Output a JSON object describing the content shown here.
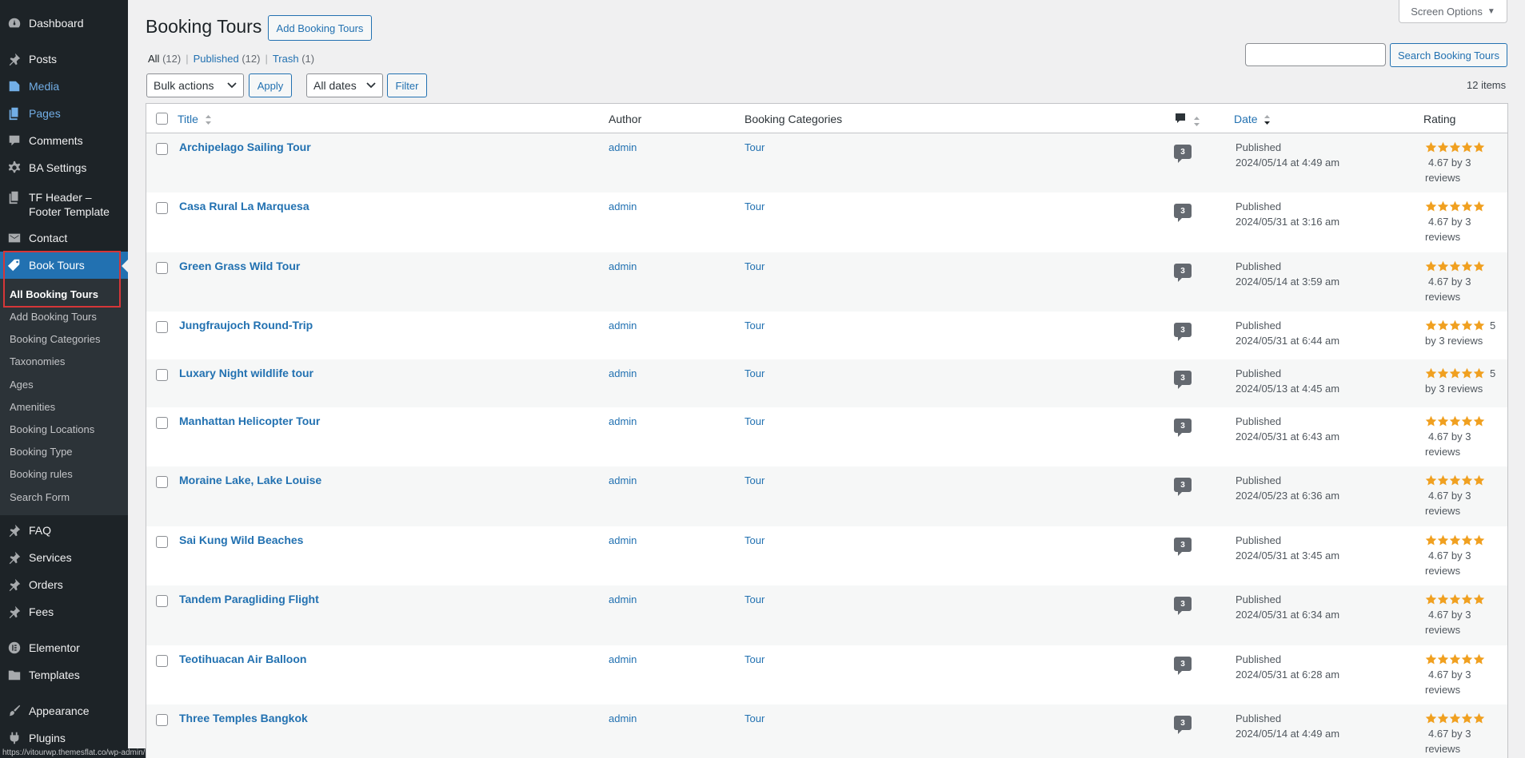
{
  "sidebar": {
    "menu": [
      {
        "label": "Dashboard",
        "icon": "dashboard-icon"
      },
      {
        "label": "Posts",
        "icon": "pin-icon"
      },
      {
        "label": "Media",
        "icon": "media-icon"
      },
      {
        "label": "Pages",
        "icon": "pages-icon"
      },
      {
        "label": "Comments",
        "icon": "comments-icon"
      },
      {
        "label": "BA Settings",
        "icon": "gear-icon"
      },
      {
        "label": "TF Header –",
        "label2": "Footer Template",
        "icon": "pages-icon"
      },
      {
        "label": "Contact",
        "icon": "mail-icon"
      },
      {
        "label": "Book Tours",
        "icon": "tag-icon"
      },
      {
        "label": "FAQ",
        "icon": "pin-icon"
      },
      {
        "label": "Services",
        "icon": "pin-icon"
      },
      {
        "label": "Orders",
        "icon": "pin-icon"
      },
      {
        "label": "Fees",
        "icon": "pin-icon"
      },
      {
        "label": "Elementor",
        "icon": "elementor-icon"
      },
      {
        "label": "Templates",
        "icon": "folder-icon"
      },
      {
        "label": "Appearance",
        "icon": "brush-icon"
      },
      {
        "label": "Plugins",
        "icon": "plugin-icon"
      }
    ],
    "submenu": [
      "All Booking Tours",
      "Add Booking Tours",
      "Booking Categories",
      "Taxonomies",
      "Ages",
      "Amenities",
      "Booking Locations",
      "Booking Type",
      "Booking rules",
      "Search Form"
    ]
  },
  "status_url": "https://vitourwp.themesflat.co/wp-admin/upload.php",
  "header": {
    "title": "Booking Tours",
    "add_button": "Add Booking Tours",
    "screen_options": "Screen Options"
  },
  "filters": {
    "all": "All",
    "all_count": "(12)",
    "published": "Published",
    "published_count": "(12)",
    "trash": "Trash",
    "trash_count": "(1)",
    "bulk_actions": "Bulk actions",
    "apply": "Apply",
    "all_dates": "All dates",
    "filter": "Filter",
    "search_button": "Search Booking Tours",
    "items_count": "12 items"
  },
  "columns": {
    "title": "Title",
    "author": "Author",
    "categories": "Booking Categories",
    "date": "Date",
    "rating": "Rating"
  },
  "colors": {
    "accent": "#2271b1",
    "sidebar": "#1d2327",
    "star": "#f0a020",
    "highlight_box": "#d63638"
  },
  "rows": [
    {
      "title": "Archipelago Sailing Tour",
      "author": "admin",
      "category": "Tour",
      "comments": "3",
      "status": "Published",
      "date": "2024/05/14 at 4:49 am",
      "rating_line1": "4.67 by 3",
      "rating_line2": "reviews",
      "stars": 5
    },
    {
      "title": "Casa Rural La Marquesa",
      "author": "admin",
      "category": "Tour",
      "comments": "3",
      "status": "Published",
      "date": "2024/05/31 at 3:16 am",
      "rating_line1": "4.67 by 3",
      "rating_line2": "reviews",
      "stars": 5
    },
    {
      "title": "Green Grass Wild Tour",
      "author": "admin",
      "category": "Tour",
      "comments": "3",
      "status": "Published",
      "date": "2024/05/14 at 3:59 am",
      "rating_line1": "4.67 by 3",
      "rating_line2": "reviews",
      "stars": 5
    },
    {
      "title": "Jungfraujoch Round-Trip",
      "author": "admin",
      "category": "Tour",
      "comments": "3",
      "status": "Published",
      "date": "2024/05/31 at 6:44 am",
      "rating_inline": "5",
      "rating_line2": "by 3 reviews",
      "stars": 5
    },
    {
      "title": "Luxary Night wildlife tour",
      "author": "admin",
      "category": "Tour",
      "comments": "3",
      "status": "Published",
      "date": "2024/05/13 at 4:45 am",
      "rating_inline": "5",
      "rating_line2": "by 3 reviews",
      "stars": 5
    },
    {
      "title": "Manhattan Helicopter Tour",
      "author": "admin",
      "category": "Tour",
      "comments": "3",
      "status": "Published",
      "date": "2024/05/31 at 6:43 am",
      "rating_line1": "4.67 by 3",
      "rating_line2": "reviews",
      "stars": 5
    },
    {
      "title": "Moraine Lake, Lake Louise",
      "author": "admin",
      "category": "Tour",
      "comments": "3",
      "status": "Published",
      "date": "2024/05/23 at 6:36 am",
      "rating_line1": "4.67 by 3",
      "rating_line2": "reviews",
      "stars": 5
    },
    {
      "title": "Sai Kung Wild Beaches",
      "author": "admin",
      "category": "Tour",
      "comments": "3",
      "status": "Published",
      "date": "2024/05/31 at 3:45 am",
      "rating_line1": "4.67 by 3",
      "rating_line2": "reviews",
      "stars": 5
    },
    {
      "title": "Tandem Paragliding Flight",
      "author": "admin",
      "category": "Tour",
      "comments": "3",
      "status": "Published",
      "date": "2024/05/31 at 6:34 am",
      "rating_line1": "4.67 by 3",
      "rating_line2": "reviews",
      "stars": 5
    },
    {
      "title": "Teotihuacan Air Balloon",
      "author": "admin",
      "category": "Tour",
      "comments": "3",
      "status": "Published",
      "date": "2024/05/31 at 6:28 am",
      "rating_line1": "4.67 by 3",
      "rating_line2": "reviews",
      "stars": 5
    },
    {
      "title": "Three Temples Bangkok",
      "author": "admin",
      "category": "Tour",
      "comments": "3",
      "status": "Published",
      "date": "2024/05/14 at 4:49 am",
      "rating_line1": "4.67 by 3",
      "rating_line2": "reviews",
      "stars": 5
    }
  ]
}
